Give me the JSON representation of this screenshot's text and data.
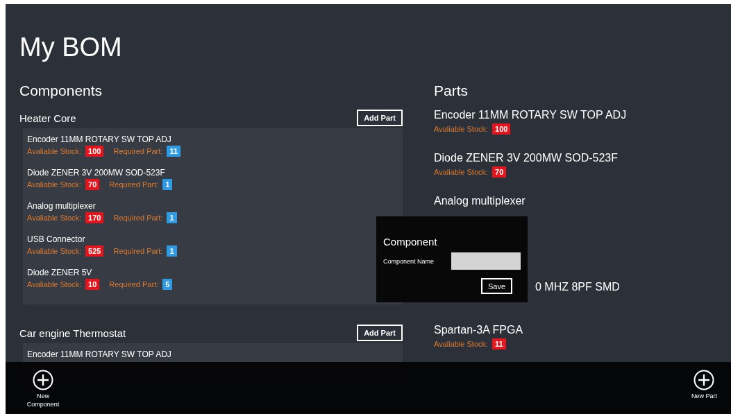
{
  "title": "My BOM",
  "components": {
    "heading": "Components",
    "groups": [
      {
        "name": "Heater Core",
        "add_button": "Add Part",
        "parts": [
          {
            "name": "Encoder 11MM ROTARY SW TOP ADJ",
            "stock_label": "Avaliable Stock:",
            "stock": "100",
            "required_label": "Required Part:",
            "required": "11"
          },
          {
            "name": "Diode ZENER 3V 200MW SOD-523F",
            "stock_label": "Avaliable Stock:",
            "stock": "70",
            "required_label": "Required Part:",
            "required": "1"
          },
          {
            "name": "Analog multiplexer",
            "stock_label": "Avaliable Stock:",
            "stock": "170",
            "required_label": "Required Part:",
            "required": "1"
          },
          {
            "name": "USB Connector",
            "stock_label": "Avaliable Stock:",
            "stock": "525",
            "required_label": "Required Part:",
            "required": "1"
          },
          {
            "name": "Diode ZENER 5V",
            "stock_label": "Avaliable Stock:",
            "stock": "10",
            "required_label": "Required Part:",
            "required": "5"
          }
        ]
      },
      {
        "name": "Car engine Thermostat",
        "add_button": "Add Part",
        "parts": [
          {
            "kind": "name_only",
            "name": "Encoder 11MM ROTARY SW TOP ADJ"
          }
        ]
      }
    ]
  },
  "parts": {
    "heading": "Parts",
    "items": [
      {
        "kind": "full",
        "name": "Encoder 11MM ROTARY SW TOP ADJ",
        "stock_label": "Avaliable Stock:",
        "stock": "100"
      },
      {
        "kind": "full",
        "name": "Diode ZENER 3V 200MW SOD-523F",
        "stock_label": "Avaliable Stock:",
        "stock": "70"
      },
      {
        "kind": "name_only",
        "name": "Analog multiplexer"
      },
      {
        "kind": "clipped",
        "name": "0 MHZ 8PF SMD"
      },
      {
        "kind": "full",
        "name": "Spartan-3A FPGA",
        "stock_label": "Avaliable Stock:",
        "stock": "11"
      }
    ]
  },
  "dialog": {
    "title": "Component",
    "field_label": "Component Name",
    "button": "Save"
  },
  "app_bar": {
    "left_button": "New Component",
    "right_button": "New Part"
  }
}
